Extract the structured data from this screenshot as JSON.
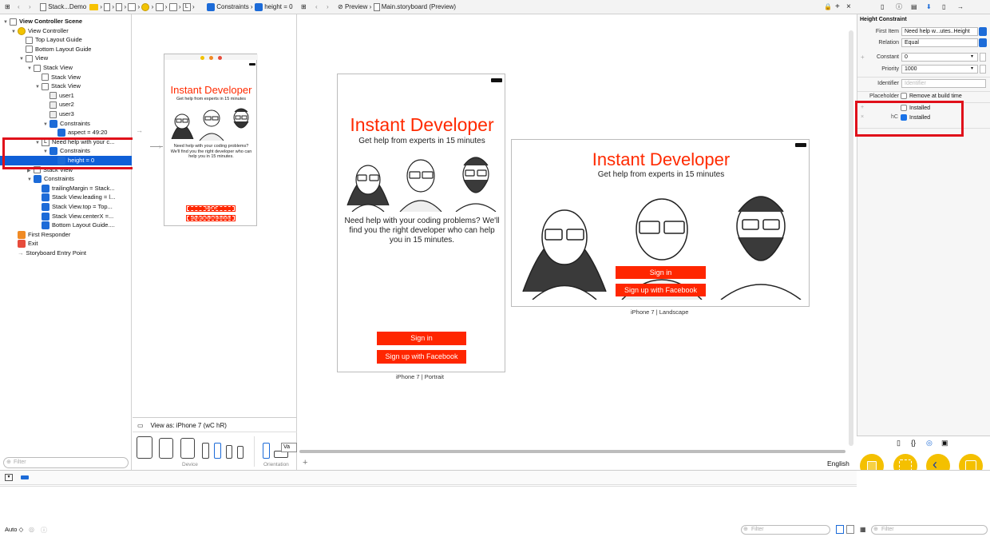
{
  "toolbar": {
    "breadcrumb_stack": "Stack...Demo",
    "breadcrumb_constraints": "Constraints",
    "breadcrumb_height": "height = 0",
    "preview_label": "Preview",
    "preview_file": "Main.storyboard (Preview)",
    "inspector_tab": "Height Constraint"
  },
  "outline": {
    "items": [
      {
        "label": "View Controller Scene",
        "depth": 0,
        "icon": "scene-icon",
        "bold": true
      },
      {
        "label": "View Controller",
        "depth": 1,
        "icon": "vc-icon"
      },
      {
        "label": "Top Layout Guide",
        "depth": 2,
        "icon": "guide-icon"
      },
      {
        "label": "Bottom Layout Guide",
        "depth": 2,
        "icon": "guide-icon"
      },
      {
        "label": "View",
        "depth": 2,
        "icon": "view-icon"
      },
      {
        "label": "Stack View",
        "depth": 3,
        "icon": "stack-icon"
      },
      {
        "label": "Stack View",
        "depth": 4,
        "icon": "stack-icon"
      },
      {
        "label": "Stack View",
        "depth": 4,
        "icon": "stack-icon"
      },
      {
        "label": "user1",
        "depth": 5,
        "icon": "image-icon"
      },
      {
        "label": "user2",
        "depth": 5,
        "icon": "image-icon"
      },
      {
        "label": "user3",
        "depth": 5,
        "icon": "image-icon"
      },
      {
        "label": "Constraints",
        "depth": 5,
        "icon": "constraints-icon"
      },
      {
        "label": "aspect = 49:20",
        "depth": 6,
        "icon": "constraint-icon"
      },
      {
        "label": "Need help with your c...",
        "depth": 4,
        "icon": "label-icon"
      },
      {
        "label": "Constraints",
        "depth": 5,
        "icon": "constraints-icon"
      },
      {
        "label": "height = 0",
        "depth": 6,
        "icon": "constraint-icon",
        "selected": true
      },
      {
        "label": "Stack View",
        "depth": 3,
        "icon": "stack-icon"
      },
      {
        "label": "Constraints",
        "depth": 3,
        "icon": "constraints-icon"
      },
      {
        "label": "trailingMargin = Stack...",
        "depth": 4,
        "icon": "constraint-icon"
      },
      {
        "label": "Stack View.leading = l...",
        "depth": 4,
        "icon": "constraint-icon"
      },
      {
        "label": "Stack View.top = Top...",
        "depth": 4,
        "icon": "constraint-icon"
      },
      {
        "label": "Stack View.centerX =...",
        "depth": 4,
        "icon": "constraint-icon"
      },
      {
        "label": "Bottom Layout Guide....",
        "depth": 4,
        "icon": "constraint-icon"
      },
      {
        "label": "First Responder",
        "depth": 1,
        "icon": "responder-icon"
      },
      {
        "label": "Exit",
        "depth": 1,
        "icon": "exit-icon"
      },
      {
        "label": "Storyboard Entry Point",
        "depth": 1,
        "icon": "arrow-icon"
      }
    ],
    "filter_placeholder": "Filter"
  },
  "mid": {
    "small_title": "Instant Developer",
    "small_sub": "Get help from experts in 15 minutes",
    "small_body": "Need help with your coding problems? We'll find you the right developer who can help you in 15 minutes.",
    "small_signin": "Sign in",
    "small_signup": "Sign up with Facebook",
    "view_as": "View as: iPhone 7 (wC hR)",
    "device_label": "Device",
    "orientation_label": "Orientation",
    "va": "Va"
  },
  "portrait": {
    "title": "Instant Developer",
    "subtitle": "Get help from experts in 15 minutes",
    "body": "Need help with your coding problems? We'll find you the right developer who can help you in 15 minutes.",
    "signin": "Sign in",
    "signup": "Sign up with Facebook",
    "caption": "iPhone 7 | Portrait"
  },
  "landscape": {
    "title": "Instant Developer",
    "subtitle": "Get help from experts in 15 minutes",
    "signin": "Sign in",
    "signup": "Sign up with Facebook",
    "caption": "iPhone 7 | Landscape"
  },
  "canvas": {
    "language": "English",
    "add": "+"
  },
  "inspector": {
    "header": "Height Constraint",
    "first_item_label": "First Item",
    "first_item_value": "Need help w...utes..Height",
    "relation_label": "Relation",
    "relation_value": "Equal",
    "constant_label": "Constant",
    "constant_value": "0",
    "priority_label": "Priority",
    "priority_value": "1000",
    "identifier_label": "Identifier",
    "identifier_placeholder": "Identifier",
    "placeholder_label": "Placeholder",
    "placeholder_value": "Remove at build time",
    "installed_1": "Installed",
    "installed_2": "Installed",
    "size_class": "hC"
  },
  "bottom": {
    "auto": "Auto ◇",
    "filter_placeholder": "Filter",
    "lib_filter_placeholder": "Filter"
  },
  "colors": {
    "accent_red": "#ff2600",
    "selection_blue": "#0f5fd7",
    "annotation_red": "#e0101a",
    "library_yellow": "#f4c000"
  }
}
